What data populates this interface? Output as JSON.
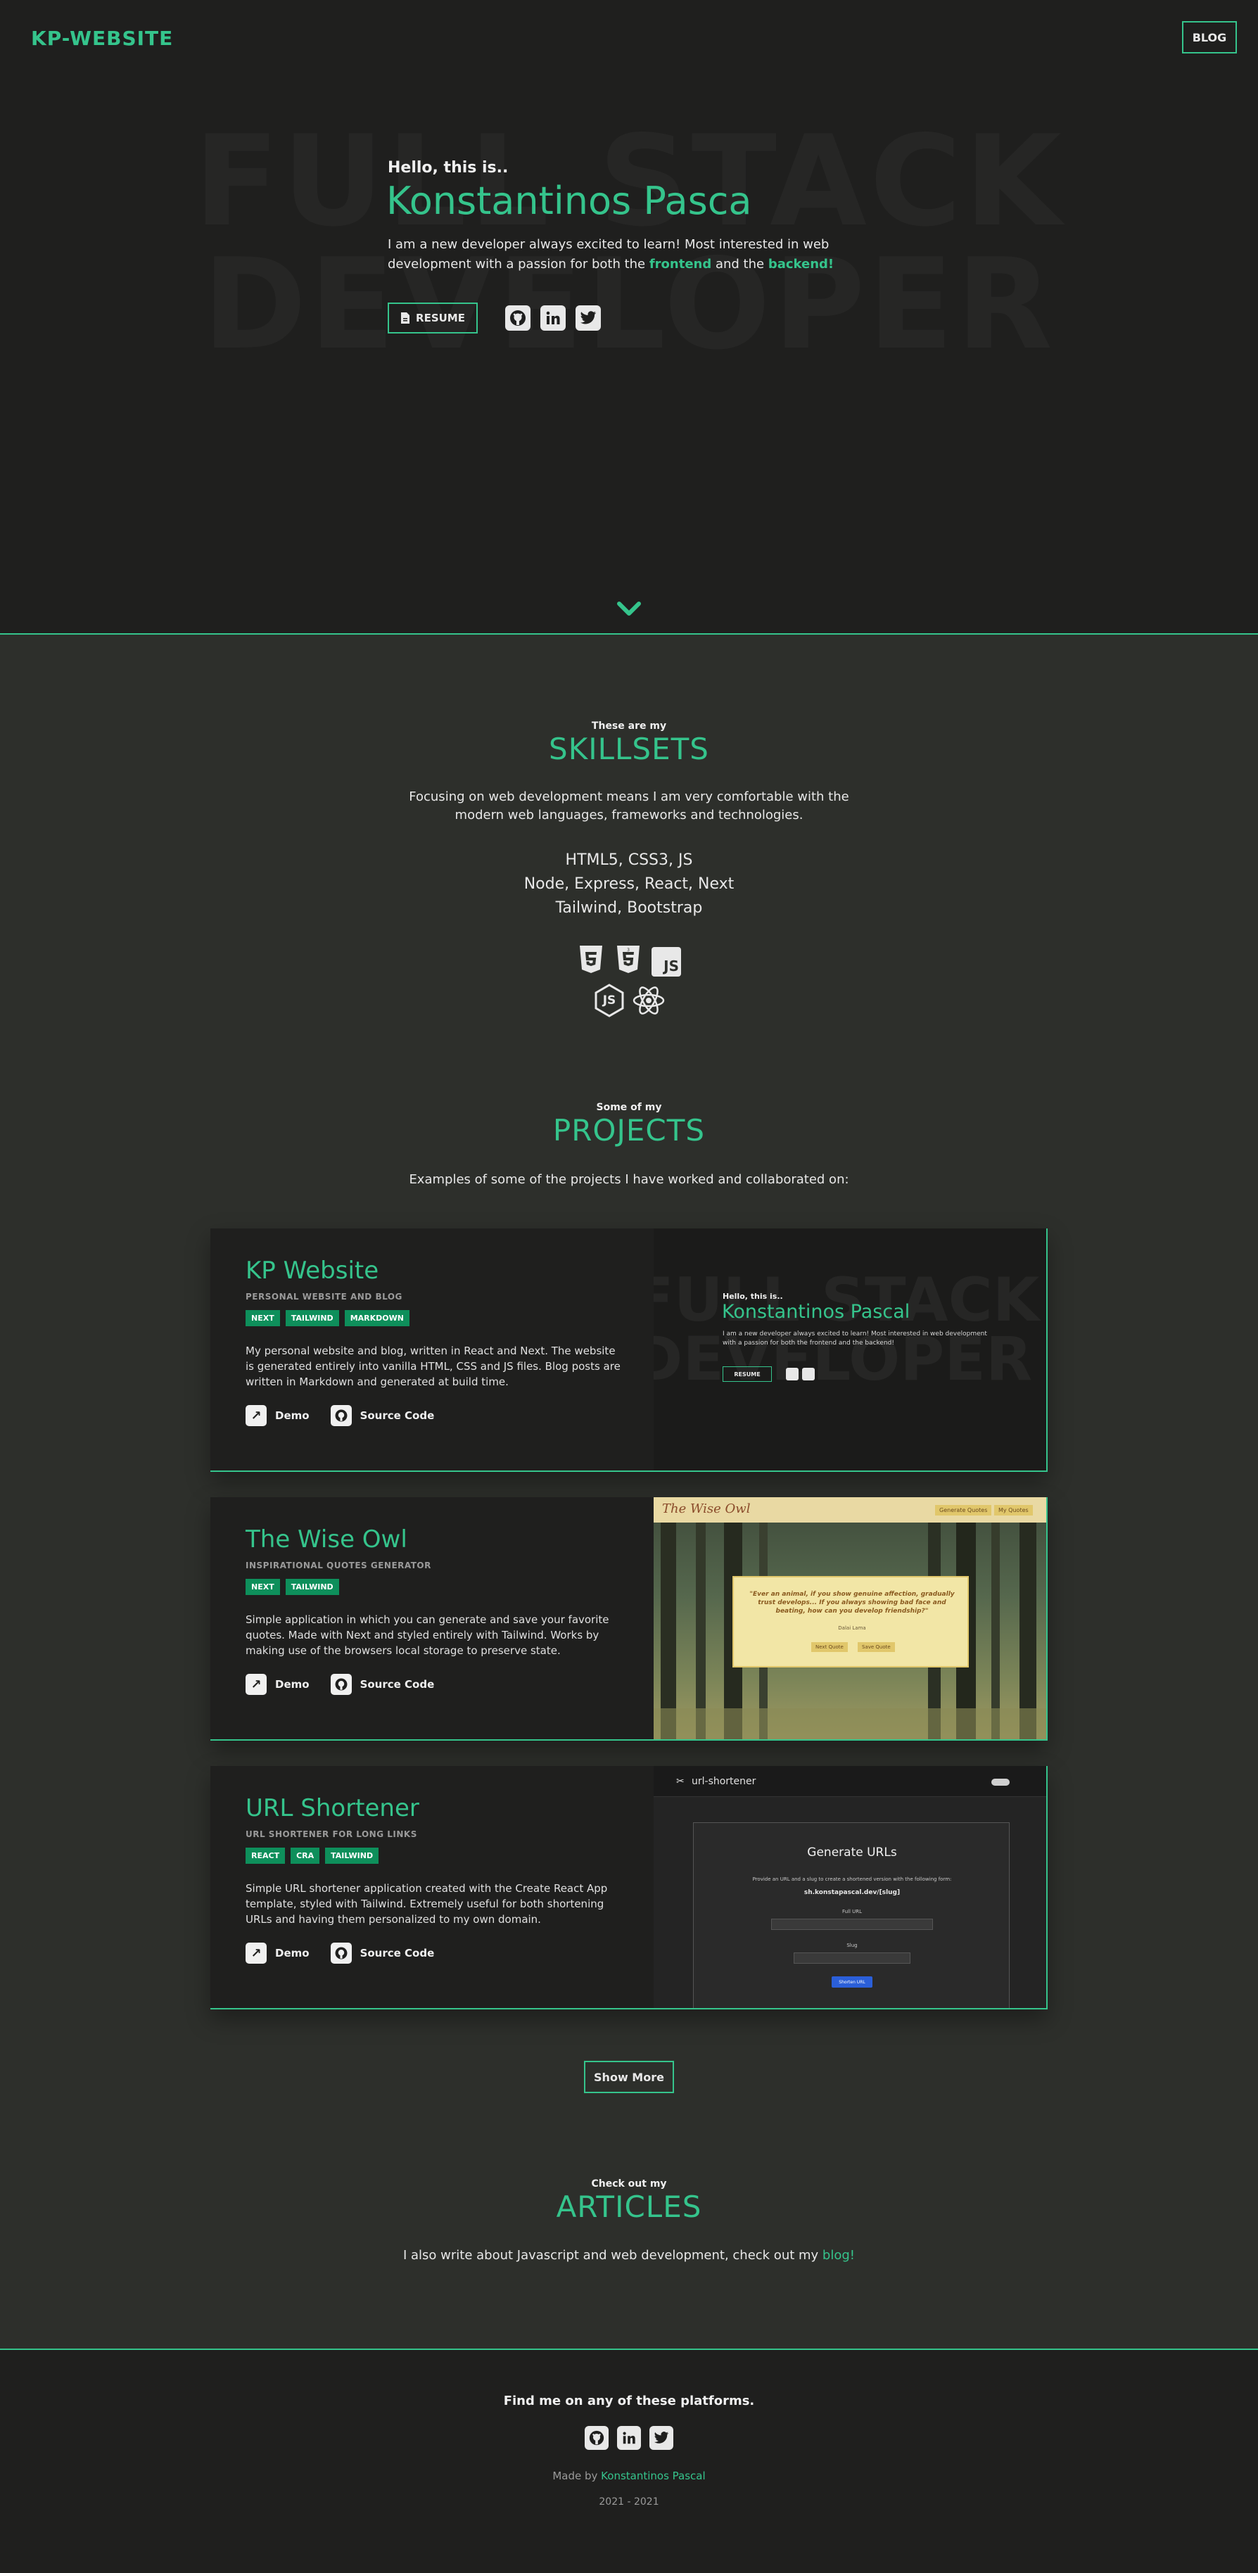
{
  "header": {
    "logo": "KP-WEBSITE",
    "blog_label": "BLOG"
  },
  "hero": {
    "bg_line1": "FULL STACK",
    "bg_line2": "DEVELOPER",
    "greeting": "Hello, this is..",
    "name": "Konstantinos Pasca",
    "desc_part1": "I am a new developer always excited to learn! Most interested in web development with a passion for both the ",
    "desc_frontend": "frontend",
    "desc_and": " and the ",
    "desc_backend": "backend!",
    "resume_label": "RESUME",
    "social_icons": [
      "github-icon",
      "linkedin-icon",
      "twitter-icon"
    ]
  },
  "skills": {
    "small": "These are my",
    "title": "SKILLSETS",
    "text": "Focusing on web development means I am very comfortable with the modern web languages, frameworks and technologies.",
    "line1": "HTML5, CSS3, JS",
    "line2": "Node, Express, React, Next",
    "line3": "Tailwind, Bootstrap",
    "js_badge": "JS",
    "node_badge": "JS",
    "icons": [
      "html5-icon",
      "css3-icon",
      "javascript-icon",
      "nodejs-icon",
      "react-icon"
    ]
  },
  "projects": {
    "small": "Some of my",
    "title": "PROJECTS",
    "text": "Examples of some of the projects I have worked and collaborated on:",
    "demo_label": "Demo",
    "source_label": "Source Code",
    "items": [
      {
        "title": "KP Website",
        "subtitle": "PERSONAL WEBSITE AND BLOG",
        "tags": [
          "NEXT",
          "TAILWIND",
          "MARKDOWN"
        ],
        "desc": "My personal website and blog, written in React and Next. The website is generated entirely into vanilla HTML, CSS and JS files. Blog posts are written in Markdown and generated at build time."
      },
      {
        "title": "The Wise Owl",
        "subtitle": "INSPIRATIONAL QUOTES GENERATOR",
        "tags": [
          "NEXT",
          "TAILWIND"
        ],
        "desc": "Simple application in which you can generate and save your favorite quotes. Made with Next and styled entirely with Tailwind. Works by making use of the browsers local storage to preserve state."
      },
      {
        "title": "URL Shortener",
        "subtitle": "URL SHORTENER FOR LONG LINKS",
        "tags": [
          "REACT",
          "CRA",
          "TAILWIND"
        ],
        "desc": "Simple URL shortener application created with the Create React App template, styled with Tailwind. Extremely useful for both shortening URLs and having them personalized to my own domain."
      }
    ],
    "preview1": {
      "bg1": "FULL STACK",
      "bg2": "DEVELOPER",
      "greeting": "Hello, this is..",
      "name": "Konstantinos Pascal",
      "desc": "I am a new developer always excited to learn! Most interested in web development with a passion for both the frontend and the backend!",
      "resume": "RESUME"
    },
    "preview2": {
      "brand": "The Wise Owl",
      "nav1": "Generate Quotes",
      "nav2": "My Quotes",
      "quote": "\"Ever an animal, if you show genuine affection, gradually trust develops... If you always showing bad face and beating, how can you develop friendship?\"",
      "author": "Dalai Lama",
      "btn1": "Next Quote",
      "btn2": "Save Quote"
    },
    "preview3": {
      "brand": "url-shortener",
      "heading": "Generate URLs",
      "hint": "Provide an URL and a slug to create a shortened version with the following form:",
      "example": "sh.konstapascal.dev/[slug]",
      "label1": "Full URL",
      "label2": "Slug",
      "button": "Shorten URL"
    },
    "show_more": "Show More"
  },
  "articles": {
    "small": "Check out my",
    "title": "ARTICLES",
    "text": "I also write about Javascript and web development, check out my ",
    "blog_link": "blog!"
  },
  "footer": {
    "title": "Find me on any of these platforms.",
    "made_by": "Made by ",
    "author": "Konstantinos Pascal",
    "years": "2021 - 2021"
  },
  "colors": {
    "accent": "#35c48c",
    "bg_dark": "#1f1f1e",
    "bg_section": "#2d2f2b",
    "tag": "#0e8f5b"
  }
}
